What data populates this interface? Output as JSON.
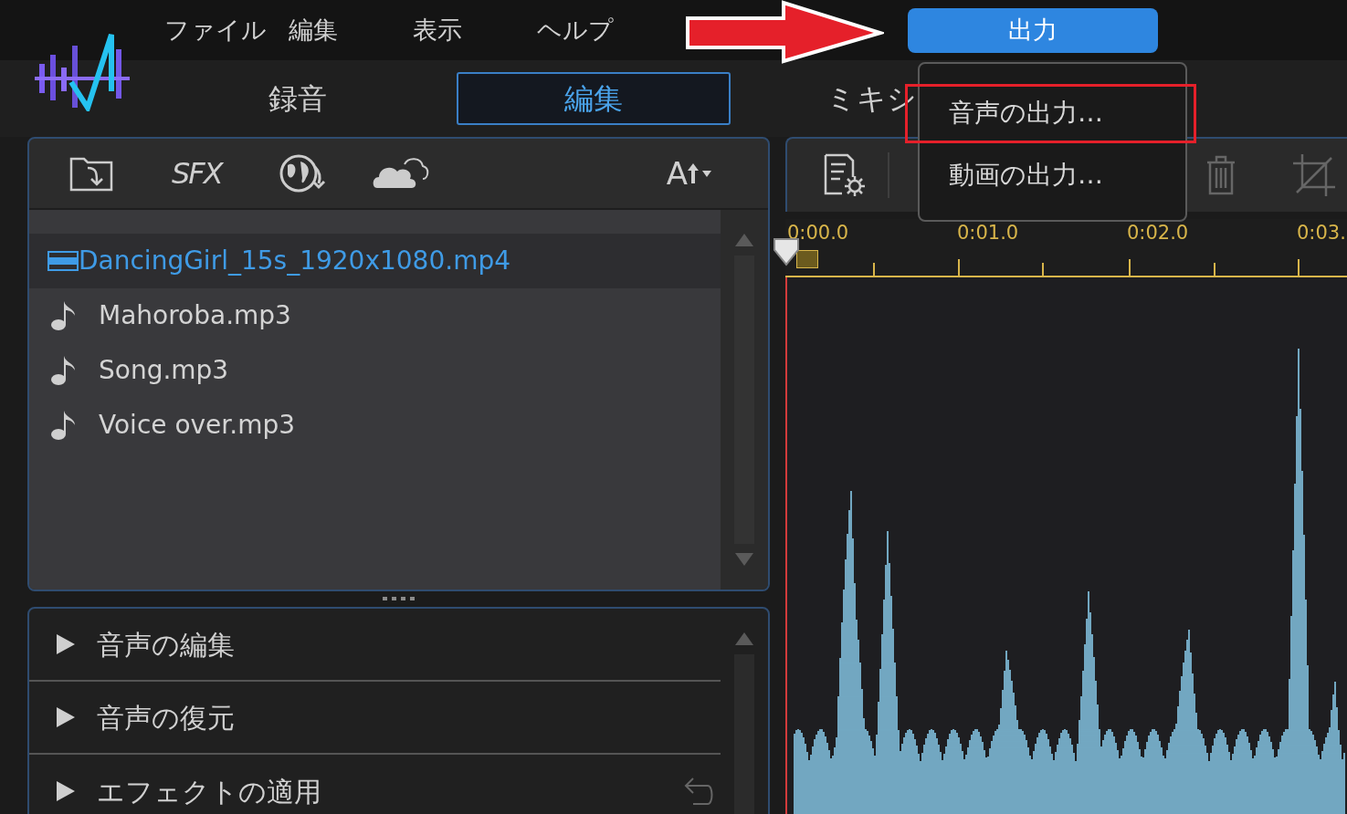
{
  "menu_bar": {
    "items": [
      {
        "label": "ファイル"
      },
      {
        "label": "編集"
      },
      {
        "label": "表示"
      },
      {
        "label": "ヘルプ"
      }
    ],
    "output_button": {
      "label": "出力",
      "selected": true
    }
  },
  "output_menu": {
    "items": [
      {
        "label": "音声の出力…",
        "highlighted": true
      },
      {
        "label": "動画の出力…",
        "highlighted": false
      }
    ]
  },
  "mode_tabs": [
    {
      "label": "録音",
      "selected": false
    },
    {
      "label": "編集",
      "selected": true
    },
    {
      "label": "ミキシ",
      "selected": false
    }
  ],
  "library": {
    "sfx_label": "SFX",
    "sort_label": "A",
    "files": [
      {
        "name": "DancingGirl_15s_1920x1080.mp4",
        "kind": "video",
        "selected": true
      },
      {
        "name": "Mahoroba.mp3",
        "kind": "audio",
        "selected": false
      },
      {
        "name": "Song.mp3",
        "kind": "audio",
        "selected": false
      },
      {
        "name": "Voice over.mp3",
        "kind": "audio",
        "selected": false
      }
    ]
  },
  "effect_sections": [
    {
      "label": "音声の編集",
      "expanded": false,
      "resettable": false
    },
    {
      "label": "音声の復元",
      "expanded": false,
      "resettable": false
    },
    {
      "label": "エフェクトの適用",
      "expanded": false,
      "resettable": true
    }
  ],
  "timeline": {
    "ruler_labels": [
      "0:00.0",
      "0:01.0",
      "0:02.0",
      "0:03."
    ]
  }
}
